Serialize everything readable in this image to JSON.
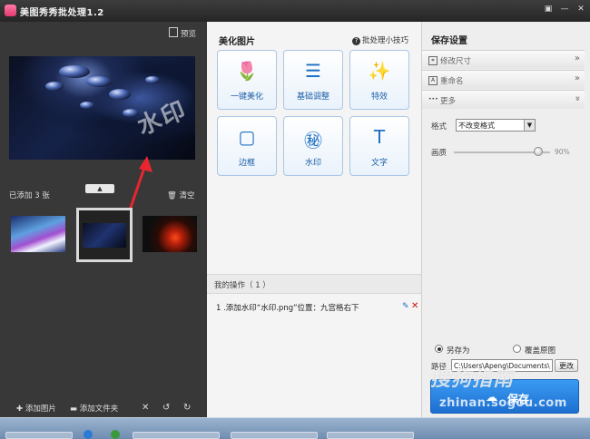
{
  "window": {
    "title": "美图秀秀批处理1.2",
    "controls": [
      "▣",
      "—",
      "✕"
    ]
  },
  "left_panel": {
    "preview_label": "预览",
    "watermark_text": "水印",
    "added_count_label": "已添加 3 张",
    "clear_label": "清空",
    "collapse_glyph": "▲",
    "actions": {
      "add_image": "添加图片",
      "add_folder": "添加文件夹"
    }
  },
  "center_panel": {
    "title": "美化图片",
    "tips_label": "批处理小技巧",
    "tools": [
      {
        "label": "一键美化",
        "icon": "tulip-icon"
      },
      {
        "label": "基础调整",
        "icon": "sliders-icon"
      },
      {
        "label": "特效",
        "icon": "magic-wand-icon"
      },
      {
        "label": "边框",
        "icon": "frame-icon"
      },
      {
        "label": "水印",
        "icon": "watermark-seal-icon"
      },
      {
        "label": "文字",
        "icon": "text-icon"
      }
    ],
    "operations_title": "我的操作（ 1 ）",
    "operations": [
      {
        "text": "1 .添加水印“水印.png”位置：九宫格右下"
      }
    ]
  },
  "right_panel": {
    "title": "保存设置",
    "sections": [
      {
        "label": "修改尺寸"
      },
      {
        "label": "重命名"
      },
      {
        "label": "更多"
      }
    ],
    "format_label": "格式",
    "format_value": "不改变格式",
    "quality_label": "画质",
    "quality_value": "90%",
    "save_as_label": "另存为",
    "overwrite_label": "覆盖原图",
    "path_label": "路径",
    "path_value": "C:\\Users\\Apeng\\Documents\\",
    "change_label": "更改",
    "save_label": "保存"
  },
  "overlay": {
    "logo_text": "搜狗指南",
    "url_text": "zhinan.sogou.com"
  },
  "colors": {
    "accent": "#1d6fd0",
    "arrow": "#e8262f"
  }
}
